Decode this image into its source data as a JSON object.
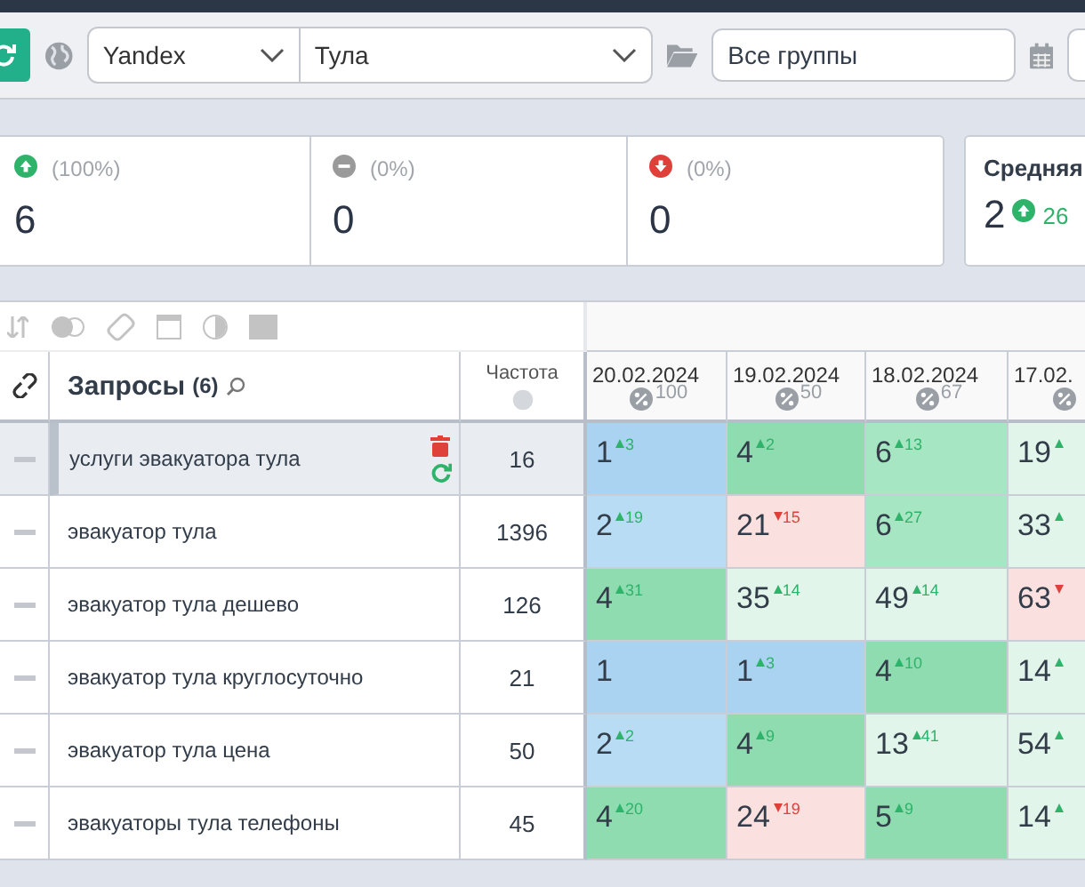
{
  "toolbar": {
    "engine": "Yandex",
    "region": "Тула",
    "group": "Все группы"
  },
  "stats": [
    {
      "kind": "up",
      "percent": "(100%)",
      "value": "6"
    },
    {
      "kind": "same",
      "percent": "(0%)",
      "value": "0"
    },
    {
      "kind": "down",
      "percent": "(0%)",
      "value": "0"
    }
  ],
  "average": {
    "title": "Средняя",
    "value": "2",
    "kind": "up",
    "change": "26"
  },
  "table": {
    "query_header": "Запросы",
    "query_count": "(6)",
    "freq_header": "Частота",
    "dates": [
      {
        "date": "20.02.2024",
        "percent": "100"
      },
      {
        "date": "19.02.2024",
        "percent": "50"
      },
      {
        "date": "18.02.2024",
        "percent": "67"
      },
      {
        "date": "17.02."
      }
    ],
    "rows": [
      {
        "query": "услуги эвакуатора тула",
        "freq": "16",
        "selected": true,
        "cells": [
          {
            "value": "1",
            "kind": "up",
            "change": "3",
            "color": "#a9d3f0"
          },
          {
            "value": "4",
            "kind": "up",
            "change": "2",
            "color": "#8fdcb0"
          },
          {
            "value": "6",
            "kind": "up",
            "change": "13",
            "color": "#a6e6c2"
          },
          {
            "value": "19",
            "kind": "up",
            "color": "#e2f5ea"
          }
        ]
      },
      {
        "query": "эвакуатор тула",
        "freq": "1396",
        "selected": false,
        "cells": [
          {
            "value": "2",
            "kind": "up",
            "change": "19",
            "color": "#b7dcf4"
          },
          {
            "value": "21",
            "kind": "down",
            "change": "15",
            "color": "#fbe0e0"
          },
          {
            "value": "6",
            "kind": "up",
            "change": "27",
            "color": "#a6e6c2"
          },
          {
            "value": "33",
            "kind": "up",
            "color": "#e2f5ea"
          }
        ]
      },
      {
        "query": "эвакуатор тула дешево",
        "freq": "126",
        "selected": false,
        "cells": [
          {
            "value": "4",
            "kind": "up",
            "change": "31",
            "color": "#8fdcb0"
          },
          {
            "value": "35",
            "kind": "up",
            "change": "14",
            "color": "#e2f5ea"
          },
          {
            "value": "49",
            "kind": "up",
            "change": "14",
            "color": "#e2f5ea"
          },
          {
            "value": "63",
            "kind": "down",
            "color": "#fbe0e0"
          }
        ]
      },
      {
        "query": "эвакуатор тула круглосуточно",
        "freq": "21",
        "selected": false,
        "cells": [
          {
            "value": "1",
            "color": "#a9d3f0"
          },
          {
            "value": "1",
            "kind": "up",
            "change": "3",
            "color": "#a9d3f0"
          },
          {
            "value": "4",
            "kind": "up",
            "change": "10",
            "color": "#8fdcb0"
          },
          {
            "value": "14",
            "kind": "up",
            "color": "#e2f5ea"
          }
        ]
      },
      {
        "query": "эвакуатор тула цена",
        "freq": "50",
        "selected": false,
        "cells": [
          {
            "value": "2",
            "kind": "up",
            "change": "2",
            "color": "#b7dcf4"
          },
          {
            "value": "4",
            "kind": "up",
            "change": "9",
            "color": "#8fdcb0"
          },
          {
            "value": "13",
            "kind": "up",
            "change": "41",
            "color": "#e2f5ea"
          },
          {
            "value": "54",
            "kind": "up",
            "color": "#e2f5ea"
          }
        ]
      },
      {
        "query": "эвакуаторы тула телефоны",
        "freq": "45",
        "selected": false,
        "cells": [
          {
            "value": "4",
            "kind": "up",
            "change": "20",
            "color": "#8fdcb0"
          },
          {
            "value": "24",
            "kind": "down",
            "change": "19",
            "color": "#fbe0e0"
          },
          {
            "value": "5",
            "kind": "up",
            "change": "9",
            "color": "#8fdcb0"
          },
          {
            "value": "14",
            "kind": "up",
            "color": "#e2f5ea"
          }
        ]
      }
    ]
  }
}
